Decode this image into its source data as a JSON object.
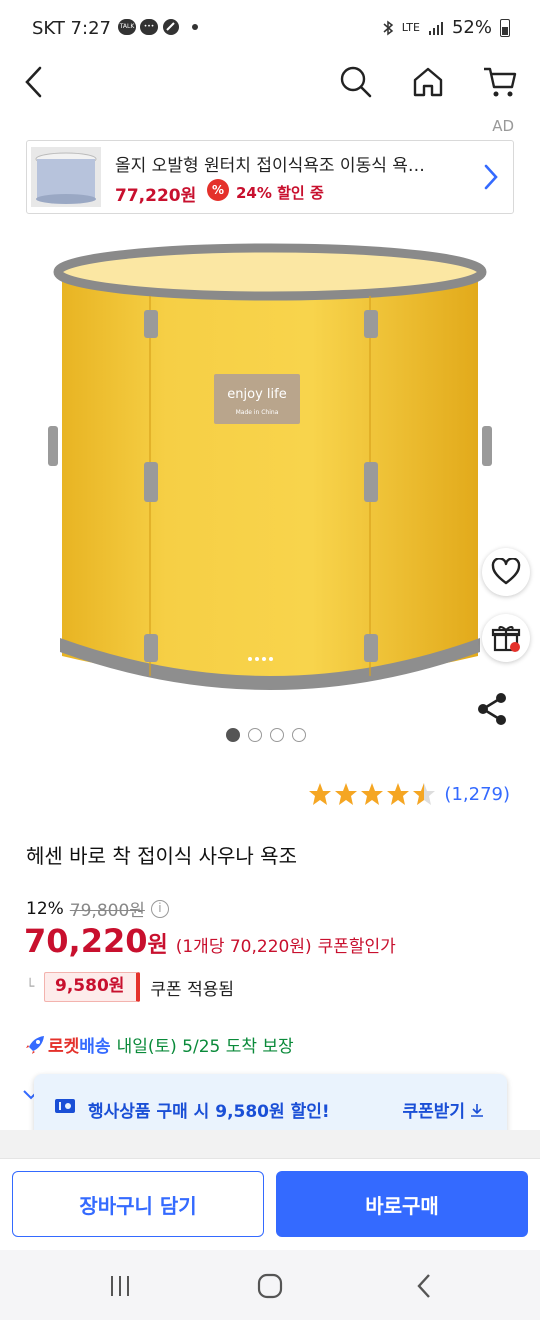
{
  "status_bar": {
    "time": "SKT 7:27",
    "network": "LTE",
    "battery": "52%"
  },
  "nav": {
    "back_icon": "chevron-left-icon",
    "search_icon": "search-icon",
    "home_icon": "home-icon",
    "cart_icon": "cart-icon"
  },
  "ad": {
    "label": "AD",
    "title": "올지 오발형 원터치 접이식욕조 이동식 욕…",
    "price": "77,220원",
    "discount_badge": "%",
    "discount_text": "24% 할인 중"
  },
  "product": {
    "image_text": "enjoy life",
    "image_subtext": "Made in China",
    "carousel_total": 4,
    "carousel_active": 1,
    "rating": 4.5,
    "review_count": "(1,279)",
    "title": "헤센 바로 착 접이식 사우나 욕조"
  },
  "pricing": {
    "discount_rate": "12%",
    "original_price": "79,800원",
    "info_icon": "i",
    "sale_price": "70,220",
    "won": "원",
    "unit_price": "(1개당 70,220원)",
    "coupon_label": "쿠폰할인가",
    "branch": "└",
    "coupon_amount": "9,580원",
    "coupon_applied": "쿠폰 적용됨"
  },
  "delivery": {
    "rocket_label": "로켓",
    "rocket_label_b": "배송",
    "eta": "내일(토) 5/25 도착 보장"
  },
  "toast": {
    "message": "행사상품 구매 시 9,580원 할인!",
    "action": "쿠폰받기"
  },
  "buttons": {
    "cart": "장바구니 담기",
    "buy": "바로구매"
  },
  "colors": {
    "accent": "#346aff",
    "price_red": "#c8102e",
    "star": "#f5a623",
    "delivery_green": "#0a8a3a"
  }
}
